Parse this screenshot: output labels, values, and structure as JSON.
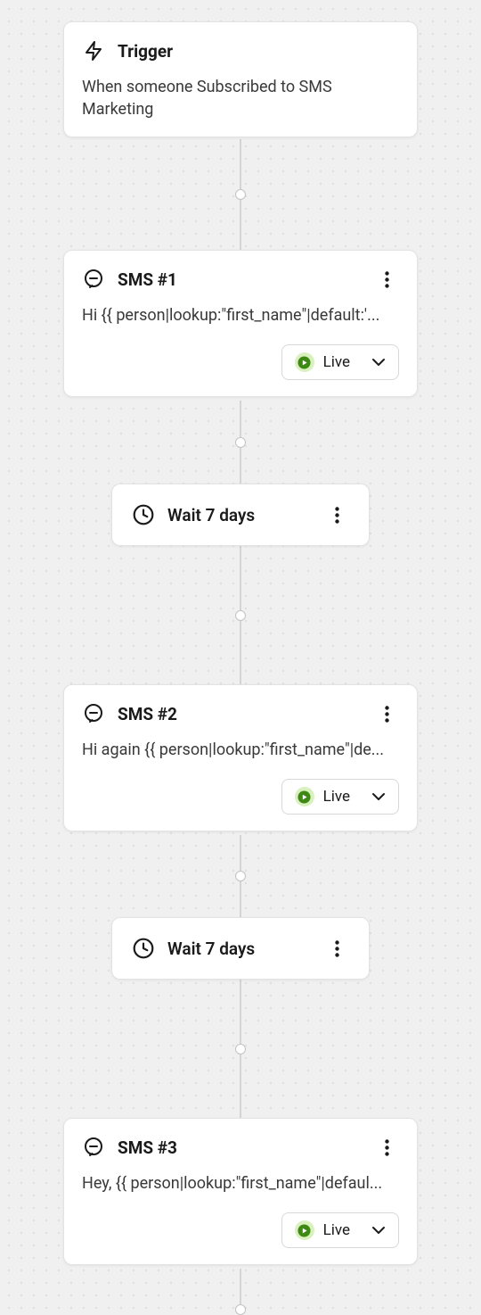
{
  "trigger": {
    "title": "Trigger",
    "description": "When someone Subscribed to SMS Marketing"
  },
  "nodes": {
    "sms1": {
      "title": "SMS #1",
      "preview": "Hi {{ person|lookup:\"first_name\"|default:'...",
      "status_label": "Live"
    },
    "wait1": {
      "title": "Wait 7 days"
    },
    "sms2": {
      "title": "SMS #2",
      "preview": "Hi again {{ person|lookup:\"first_name\"|de...",
      "status_label": "Live"
    },
    "wait2": {
      "title": "Wait 7 days"
    },
    "sms3": {
      "title": "SMS #3",
      "preview": "Hey, {{ person|lookup:\"first_name\"|defaul...",
      "status_label": "Live"
    }
  },
  "icons": {
    "trigger": "bolt-icon",
    "sms": "sms-icon",
    "wait": "clock-icon",
    "more": "more-vertical-icon",
    "status": "play-circle-icon",
    "chevron": "chevron-down-icon"
  },
  "colors": {
    "status_green": "#3e8914",
    "card_border": "#e3e3e3",
    "text": "#1a1a1a"
  }
}
